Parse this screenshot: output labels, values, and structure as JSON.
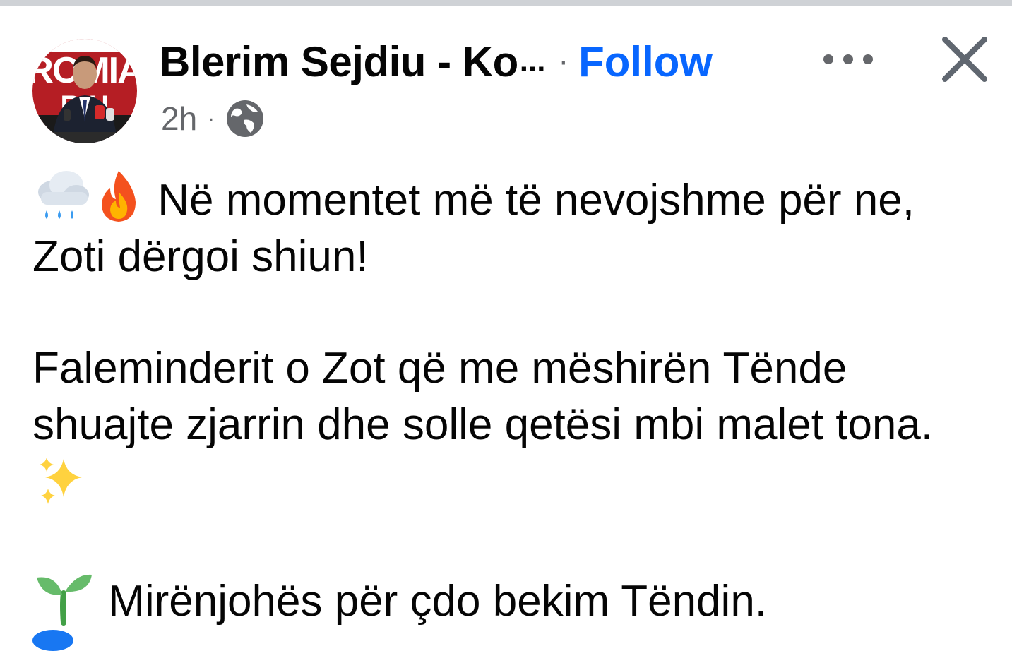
{
  "post": {
    "author": "Blerim Sejdiu - Ko",
    "author_truncation": "...",
    "separator": "·",
    "follow_label": "Follow",
    "timestamp": "2h",
    "meta_separator": "·",
    "privacy_icon": "globe-icon",
    "avatar": {
      "banner_text_top": "ROMIA",
      "banner_text_bottom": "R H"
    },
    "body": {
      "line1_emojis": [
        "cloud-with-rain-icon",
        "fire-icon"
      ],
      "paragraph1": "Në momentet më të nevojshme për ne, Zoti dërgoi shiun!",
      "paragraph2": "Faleminderit o Zot që me mëshirën Tënde shuajte zjarrin dhe solle qetësi mbi malet tona.",
      "paragraph2_emoji": "sparkles-icon",
      "paragraph3_emoji": "seedling-icon",
      "paragraph3": "Mirënjohës për çdo bekim Tëndin."
    }
  },
  "colors": {
    "follow": "#0866ff",
    "secondary_text": "#65676b",
    "primary_text": "#050505",
    "top_strip": "#cfd2d6"
  }
}
